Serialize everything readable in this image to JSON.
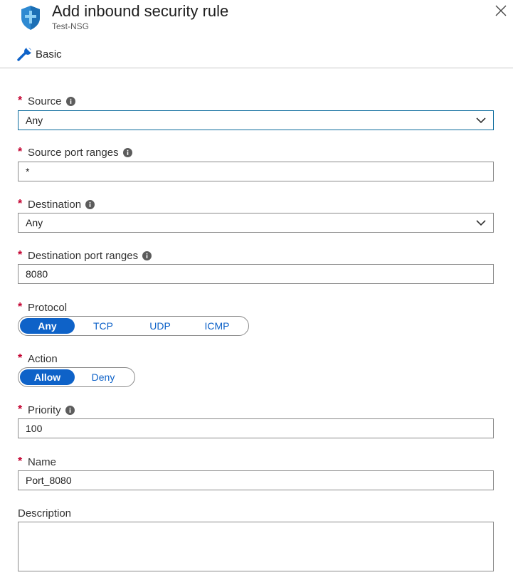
{
  "header": {
    "title": "Add inbound security rule",
    "subtitle": "Test-NSG",
    "tab_label": "Basic"
  },
  "colors": {
    "accent": "#0e62c8",
    "required": "#c3002f",
    "focus_border": "#0a6a9c"
  },
  "form": {
    "required_marker": "*",
    "source": {
      "label": "Source",
      "value": "Any"
    },
    "source_port_ranges": {
      "label": "Source port ranges",
      "value": "*"
    },
    "destination": {
      "label": "Destination",
      "value": "Any"
    },
    "destination_port_ranges": {
      "label": "Destination port ranges",
      "value": "8080"
    },
    "protocol": {
      "label": "Protocol",
      "options": [
        "Any",
        "TCP",
        "UDP",
        "ICMP"
      ],
      "selected": "Any"
    },
    "action": {
      "label": "Action",
      "options": [
        "Allow",
        "Deny"
      ],
      "selected": "Allow"
    },
    "priority": {
      "label": "Priority",
      "value": "100"
    },
    "name": {
      "label": "Name",
      "value": "Port_8080"
    },
    "description": {
      "label": "Description",
      "value": ""
    }
  }
}
